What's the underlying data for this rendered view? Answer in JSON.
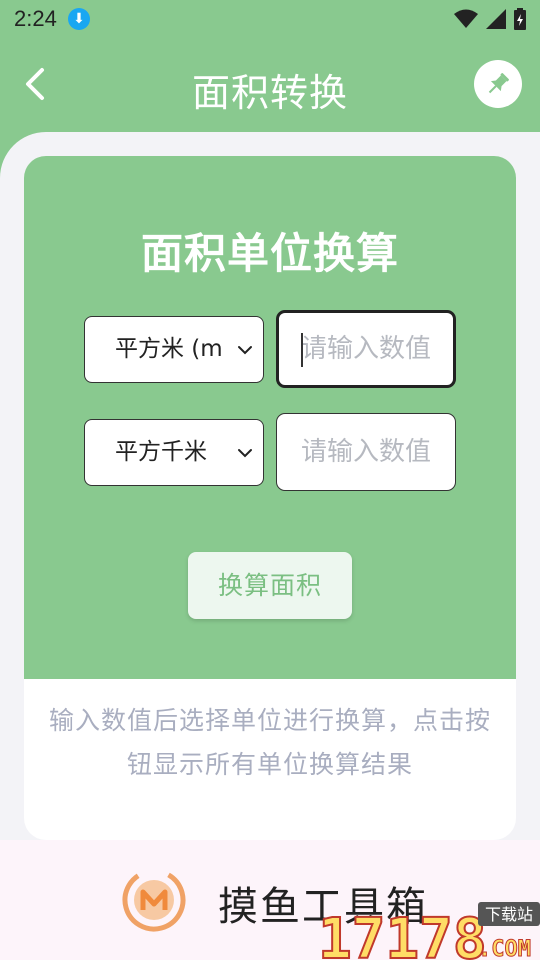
{
  "status": {
    "time": "2:24"
  },
  "header": {
    "title": "面积转换"
  },
  "card": {
    "title": "面积单位换算",
    "from_unit": "平方米 (m",
    "to_unit": "平方千米",
    "from_placeholder": "请输入数值",
    "to_placeholder": "请输入数值",
    "button_label": "换算面积"
  },
  "hint": "输入数值后选择单位进行换算，点击按钮显示所有单位换算结果",
  "footer": {
    "app_name": "摸鱼工具箱"
  },
  "watermark": {
    "number": "17178",
    "tag": "下载站",
    "suffix": ".COM"
  },
  "colors": {
    "primary": "#89c98f",
    "accent_orange": "#f0a266",
    "placeholder": "#b6b9c0"
  },
  "icons": [
    "download-icon",
    "wifi-icon",
    "signal-icon",
    "battery-icon",
    "back-arrow-icon",
    "pin-icon",
    "chevron-down-icon",
    "app-logo-icon"
  ]
}
